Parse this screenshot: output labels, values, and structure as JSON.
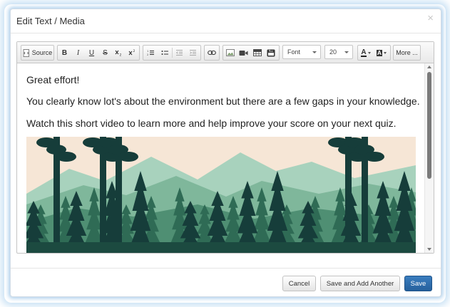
{
  "dialog": {
    "title": "Edit Text / Media",
    "close_glyph": "×"
  },
  "toolbar": {
    "source_label": "Source",
    "bold_label": "B",
    "italic_label": "I",
    "underline_label": "U",
    "strike_label": "S",
    "font_label": "Font",
    "size_value": "20",
    "text_color_label": "A",
    "bg_color_label": "A",
    "more_label": "More ...",
    "icons": [
      "source-icon",
      "bold-icon",
      "italic-icon",
      "underline-icon",
      "strikethrough-icon",
      "subscript-icon",
      "superscript-icon",
      "numbered-list-icon",
      "bulleted-list-icon",
      "decrease-indent-icon",
      "increase-indent-icon",
      "link-icon",
      "image-icon",
      "video-icon",
      "table-icon",
      "youtube-icon",
      "text-color-icon",
      "background-color-icon"
    ]
  },
  "content": {
    "paragraphs": [
      "Great effort!",
      "You clearly know lot's about the environment but there are a few gaps in your knowledge.",
      "Watch this short video to learn more and help improve your score on your next quiz."
    ]
  },
  "footer": {
    "cancel_label": "Cancel",
    "save_add_label": "Save and Add Another",
    "save_label": "Save"
  },
  "colors": {
    "primary": "#2a6aa8",
    "forest_dark": "#163d3a",
    "forest_mid": "#2f6b55",
    "forest_light": "#8cc4a6",
    "sky": "#f6e6d6"
  }
}
